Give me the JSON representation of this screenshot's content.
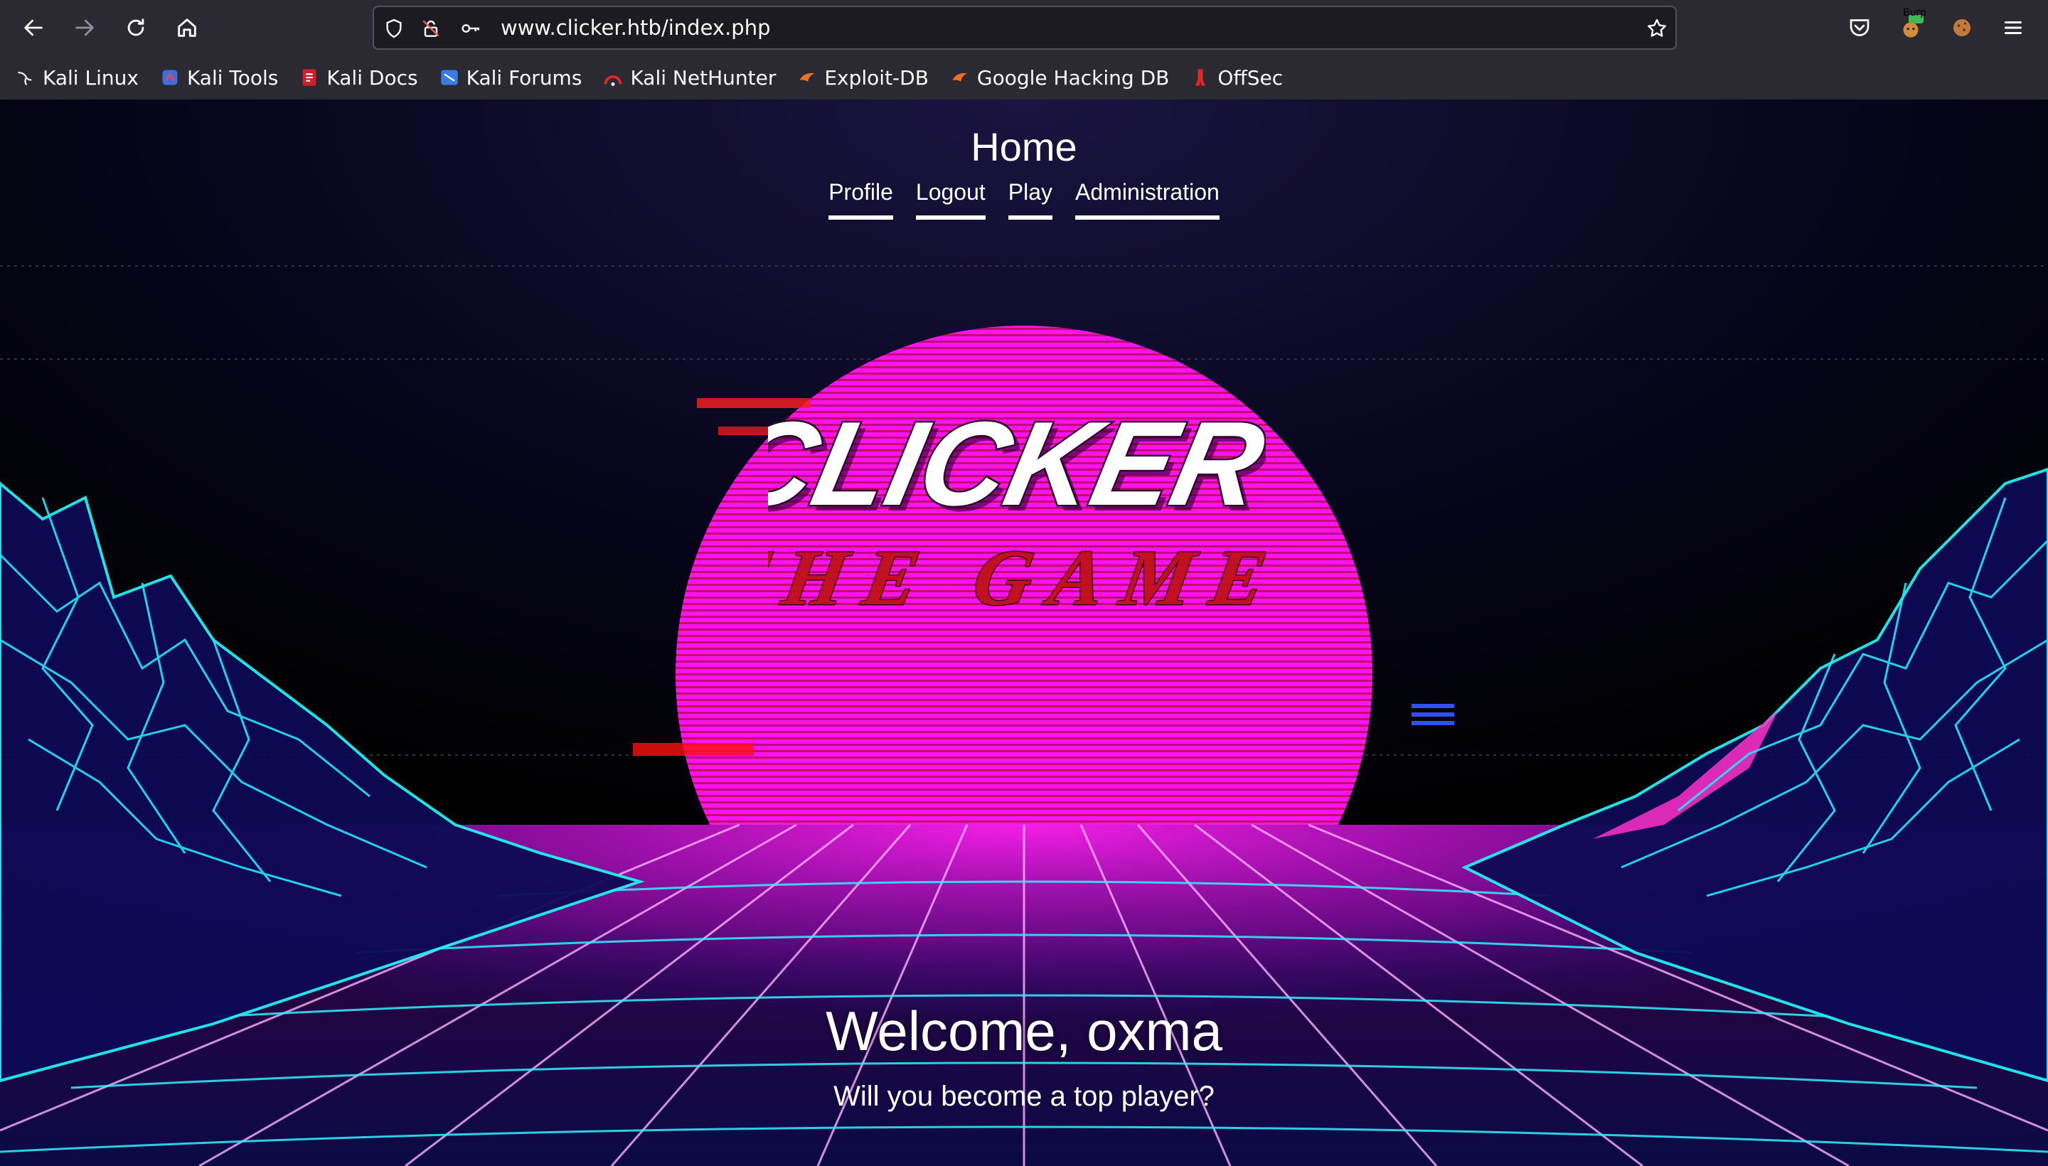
{
  "browser": {
    "url": "www.clicker.htb/index.php",
    "bookmarks": [
      {
        "label": "Kali Linux",
        "icon": "kali-dragon-icon"
      },
      {
        "label": "Kali Tools",
        "icon": "kali-tools-icon"
      },
      {
        "label": "Kali Docs",
        "icon": "kali-docs-icon"
      },
      {
        "label": "Kali Forums",
        "icon": "kali-forums-icon"
      },
      {
        "label": "Kali NetHunter",
        "icon": "kali-nethunter-icon"
      },
      {
        "label": "Exploit-DB",
        "icon": "exploit-db-icon"
      },
      {
        "label": "Google Hacking DB",
        "icon": "ghdb-icon"
      },
      {
        "label": "OffSec",
        "icon": "offsec-icon"
      }
    ],
    "extension_badge": "Burp"
  },
  "page": {
    "title": "Home",
    "nav": [
      {
        "label": "Profile"
      },
      {
        "label": "Logout"
      },
      {
        "label": "Play"
      },
      {
        "label": "Administration"
      }
    ],
    "logo": {
      "line1": "CLICKER",
      "line2": "THE GAME"
    },
    "welcome": "Welcome, oxma",
    "subtitle": "Will you become a top player?"
  },
  "colors": {
    "toolbar": "#2b2a33",
    "urlbar": "#1c1b22",
    "sun": "#ff10f0",
    "grid": "#18e0ff",
    "logo_red": "#c0101a"
  }
}
